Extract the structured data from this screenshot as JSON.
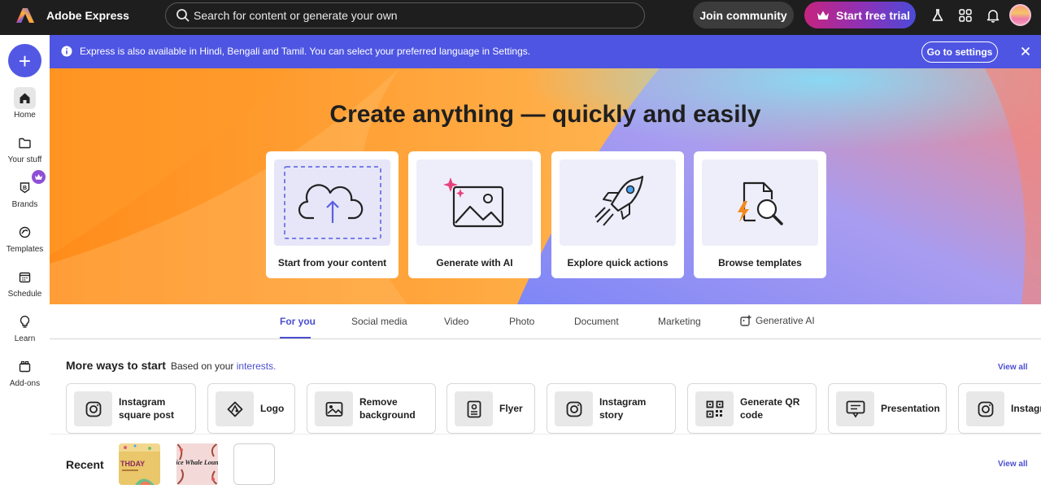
{
  "app": {
    "name": "Adobe Express"
  },
  "topbar": {
    "search_placeholder": "Search for content or generate your own",
    "join_label": "Join community",
    "trial_label": "Start free trial",
    "icons": [
      "labs-flask-icon",
      "apps-grid-icon",
      "bell-icon",
      "avatar"
    ]
  },
  "sidebar": {
    "create_icon": "+",
    "items": [
      {
        "label": "Home",
        "icon": "home-icon",
        "active": true
      },
      {
        "label": "Your stuff",
        "icon": "folder-icon"
      },
      {
        "label": "Brands",
        "icon": "brand-icon",
        "badge": "crown"
      },
      {
        "label": "Templates",
        "icon": "templates-icon"
      },
      {
        "label": "Schedule",
        "icon": "calendar-icon"
      },
      {
        "label": "Learn",
        "icon": "lightbulb-icon"
      },
      {
        "label": "Add-ons",
        "icon": "addons-icon"
      }
    ]
  },
  "banner": {
    "text": "Express is also available in Hindi, Bengali and Tamil. You can select your preferred language in Settings.",
    "button_label": "Go to settings"
  },
  "hero": {
    "title": "Create anything — quickly and easily",
    "cards": [
      {
        "label": "Start from your content",
        "icon": "cloud-upload-icon"
      },
      {
        "label": "Generate with AI",
        "icon": "ai-image-icon"
      },
      {
        "label": "Explore quick actions",
        "icon": "rocket-icon"
      },
      {
        "label": "Browse templates",
        "icon": "template-search-icon"
      }
    ]
  },
  "tabs": [
    {
      "label": "For you",
      "active": true
    },
    {
      "label": "Social media"
    },
    {
      "label": "Video"
    },
    {
      "label": "Photo"
    },
    {
      "label": "Document"
    },
    {
      "label": "Marketing"
    },
    {
      "label": "Generative AI",
      "icon": "generative-ai-icon"
    }
  ],
  "more_ways": {
    "title": "More ways to start",
    "subtitle_prefix": "Based on your",
    "subtitle_link": "interests.",
    "view_all": "View all",
    "items": [
      {
        "label": "Instagram\nsquare post",
        "icon": "instagram-icon"
      },
      {
        "label": "Logo",
        "icon": "logo-icon"
      },
      {
        "label": "Remove\nbackground",
        "icon": "remove-background-icon"
      },
      {
        "label": "Flyer",
        "icon": "flyer-icon"
      },
      {
        "label": "Instagram\nstory",
        "icon": "instagram-icon"
      },
      {
        "label": "Generate QR\ncode",
        "icon": "qr-code-icon"
      },
      {
        "label": "Presentation",
        "icon": "presentation-icon"
      },
      {
        "label": "Instagra",
        "icon": "instagram-icon"
      }
    ]
  },
  "recent": {
    "title": "Recent",
    "view_all": "View all",
    "thumbs": [
      {
        "text": "THDAY"
      },
      {
        "text": "Alice Whale Lounge"
      }
    ]
  },
  "colors": {
    "accent": "#5258e4",
    "topbar": "#1e1e1e",
    "banner": "#4e55e2",
    "hero_orange": "#f7a23f",
    "hero_blue": "#8f98f8"
  }
}
